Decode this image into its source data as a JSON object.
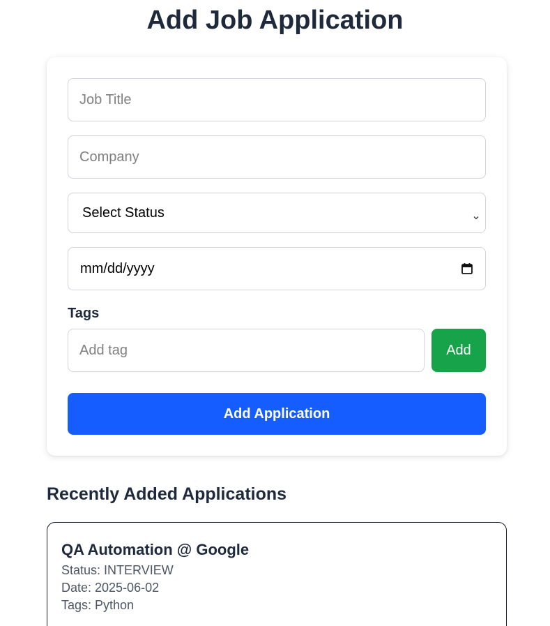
{
  "page": {
    "title": "Add Job Application"
  },
  "form": {
    "job_title": {
      "placeholder": "Job Title",
      "value": ""
    },
    "company": {
      "placeholder": "Company",
      "value": ""
    },
    "status": {
      "selected": "Select Status"
    },
    "date": {
      "display": "mm/dd/yyyy"
    },
    "tags_label": "Tags",
    "tag_input": {
      "placeholder": "Add tag",
      "value": ""
    },
    "add_tag_label": "Add",
    "submit_label": "Add Application"
  },
  "recent": {
    "heading": "Recently Added Applications",
    "items": [
      {
        "title": "QA Automation @ Google",
        "status": "Status: INTERVIEW",
        "date": "Date: 2025-06-02",
        "tags": "Tags: Python"
      }
    ]
  },
  "colors": {
    "add_tag_button": "#16a34a",
    "submit_button": "#165dff",
    "heading_text": "#1e293b"
  },
  "icons": {
    "status_select": "chevron-down-icon",
    "date_input": "calendar-icon"
  }
}
